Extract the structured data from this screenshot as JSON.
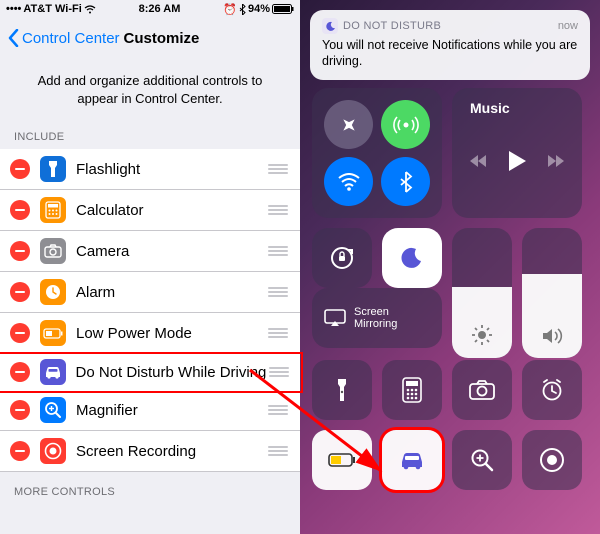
{
  "status": {
    "carrier": "AT&T Wi-Fi",
    "time": "8:26 AM",
    "battery": "94%"
  },
  "nav": {
    "back": "Control Center",
    "title": "Customize"
  },
  "desc": "Add and organize additional controls to appear in Control Center.",
  "section_include": "INCLUDE",
  "section_more": "MORE CONTROLS",
  "items": [
    {
      "label": "Flashlight",
      "icon_bg": "#0f6fd8",
      "glyph": "flashlight"
    },
    {
      "label": "Calculator",
      "icon_bg": "#ff9500",
      "glyph": "calc"
    },
    {
      "label": "Camera",
      "icon_bg": "#8e8e93",
      "glyph": "camera"
    },
    {
      "label": "Alarm",
      "icon_bg": "#ff9500",
      "glyph": "clock"
    },
    {
      "label": "Low Power Mode",
      "icon_bg": "#ff9500",
      "glyph": "battery"
    },
    {
      "label": "Do Not Disturb While Driving",
      "icon_bg": "#5856d6",
      "glyph": "car",
      "hl": true
    },
    {
      "label": "Magnifier",
      "icon_bg": "#007aff",
      "glyph": "magnifier"
    },
    {
      "label": "Screen Recording",
      "icon_bg": "#ff3b30",
      "glyph": "record"
    }
  ],
  "notif": {
    "title": "DO NOT DISTURB",
    "time": "now",
    "body": "You will not receive Notifications while you are driving."
  },
  "music": {
    "label": "Music"
  },
  "screen_mirroring": "Screen\nMirroring",
  "brightness": 55,
  "volume": 65,
  "moon_active": true
}
